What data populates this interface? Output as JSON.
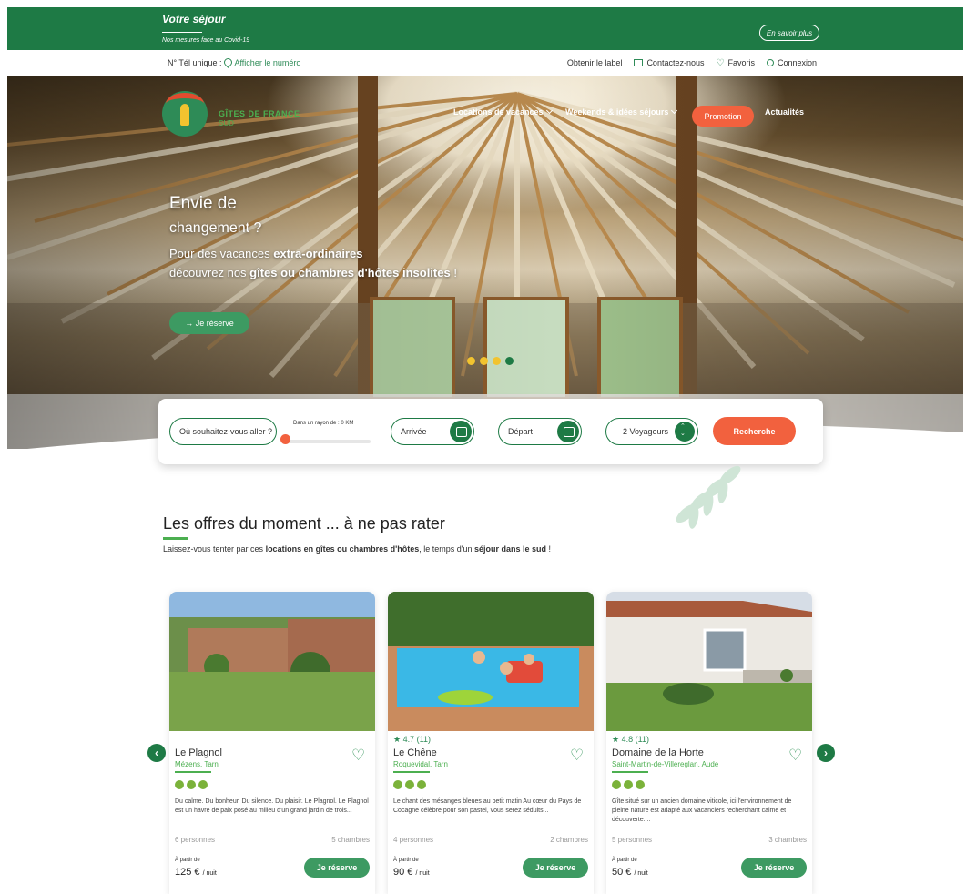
{
  "banner": {
    "title": "Votre séjour",
    "subtitle": "Nos mesures face au Covid-19",
    "button": "En savoir plus"
  },
  "utility": {
    "phone_label": "N° Tél unique :",
    "phone_link": "Afficher le numéro",
    "label_link": "Obtenir le label",
    "contact": "Contactez-nous",
    "favoris": "Favoris",
    "connexion": "Connexion"
  },
  "logo": {
    "line1": "GÎTES DE FRANCE",
    "line2": "SUD"
  },
  "nav": {
    "item1": "Locations de vacances",
    "item2": "Weekends & idées séjours",
    "promo": "Promotion",
    "item4": "Actualités"
  },
  "hero": {
    "h1": "Envie de",
    "h2": "changement ?",
    "p1_a": "Pour des vacances ",
    "p1_b": "extra-ordinaires",
    "p2_a": "découvrez nos ",
    "p2_b": "gîtes ou chambres d'hôtes insolites",
    "p2_c": " !",
    "cta": "→ Je réserve",
    "slide_count": 4,
    "active_slide": 4
  },
  "search": {
    "where": "Où souhaitez-vous aller ?",
    "radius_label": "Dans un rayon de : 0 KM",
    "radius_value": 0,
    "arrival": "Arrivée",
    "departure": "Départ",
    "travellers": "2 Voyageurs",
    "submit": "Recherche"
  },
  "section": {
    "title": "Les offres du moment ... à ne pas rater",
    "sub_a": "Laissez-vous tenter par ces ",
    "sub_b": "locations en gîtes ou chambres d'hôtes",
    "sub_c": ", le temps d'un ",
    "sub_d": "séjour dans le sud",
    "sub_e": " !"
  },
  "cards": [
    {
      "rating": "",
      "name": "Le Plagnol",
      "location": "Mézens, Tarn",
      "description": "Du calme. Du bonheur. Du silence. Du plaisir. Le Plagnol. Le Plagnol est un havre de paix posé au milieu d'un grand jardin de trois...",
      "persons": "6 personnes",
      "rooms": "5 chambres",
      "from_label": "À partir de",
      "price": "125 €",
      "per": "/ nuit",
      "book": "Je réserve",
      "epis": 3
    },
    {
      "rating": "4.7 (11)",
      "name": "Le Chêne",
      "location": "Roquevidal, Tarn",
      "description": "Le chant des mésanges bleues au petit matin Au cœur du Pays de Cocagne célèbre pour son pastel, vous serez séduits...",
      "persons": "4 personnes",
      "rooms": "2 chambres",
      "from_label": "À partir de",
      "price": "90 €",
      "per": "/ nuit",
      "book": "Je réserve",
      "epis": 3
    },
    {
      "rating": "4.8 (11)",
      "name": "Domaine de la Horte",
      "location": "Saint-Martin-de-Villereglan, Aude",
      "description": "Gîte situé sur un ancien domaine viticole, ici l'environnement de pleine nature est adapté aux vacanciers recherchant calme et découverte....",
      "persons": "5 personnes",
      "rooms": "3 chambres",
      "from_label": "À partir de",
      "price": "50 €",
      "per": "/ nuit",
      "book": "Je réserve",
      "epis": 3
    }
  ],
  "carousel": {
    "prev": "‹",
    "next": "›"
  },
  "colors": {
    "brand_green": "#1e7a45",
    "accent_orange": "#f2613e",
    "light_green": "#4caf50",
    "epi_green": "#7bb23a"
  }
}
